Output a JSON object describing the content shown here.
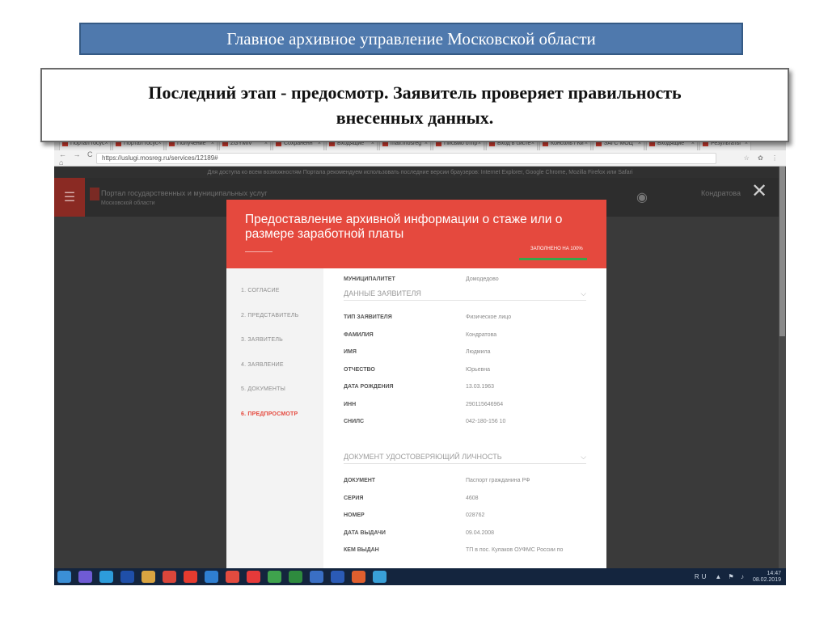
{
  "slide": {
    "title": "Главное архивное управление Московской области",
    "callout_line1": "Последний этап - предосмотр. Заявитель проверяет правильность",
    "callout_line2": "внесенных данных."
  },
  "browser": {
    "tabs": [
      "Портал госус",
      "Портал госус",
      "Получение",
      "ZGYMIV",
      "Сохраненн",
      "Входящие",
      "mail.mosreg",
      "Письмо отпр",
      "Вход в систе",
      "Консоль / Ки",
      "ЗАГС МОЦ",
      "Входящие",
      "Результаты"
    ],
    "nav_icons": "← → C ⌂",
    "url": "https://uslugi.mosreg.ru/services/12189#",
    "infobar": "Для доступа ко всем возможностям Портала рекомендуем использовать последние версии браузеров: Internet Explorer, Google Chrome, Mozilla Firefox или Safari",
    "menu_icon": "☰",
    "portal_name": "Портал государственных и муниципальных услуг",
    "portal_sub": "Московской области",
    "header_user": "Кондратова",
    "close_symbol": "✕"
  },
  "modal": {
    "title": "Предоставление архивной информации о стаже или о размере заработной платы",
    "fill_status": "ЗАПОЛНЕНО НА 100%",
    "fill_fraction": 1.0,
    "steps": [
      "1.  СОГЛАСИЕ",
      "2.  ПРЕДСТАВИТЕЛЬ",
      "3.  ЗАЯВИТЕЛЬ",
      "4.  ЗАЯВЛЕНИЕ",
      "5.  ДОКУМЕНТЫ",
      "6.  ПРЕДПРОСМОТР"
    ],
    "municipality_label": "МУНИЦИПАЛИТЕТ",
    "municipality_value": "Домодедово",
    "section_applicant": "ДАННЫЕ ЗАЯВИТЕЛЯ",
    "applicant_rows": [
      {
        "label": "ТИП ЗАЯВИТЕЛЯ",
        "value": "Физическое лицо"
      },
      {
        "label": "ФАМИЛИЯ",
        "value": "Кондратова"
      },
      {
        "label": "ИМЯ",
        "value": "Людмила"
      },
      {
        "label": "ОТЧЕСТВО",
        "value": "Юрьевна"
      },
      {
        "label": "ДАТА РОЖДЕНИЯ",
        "value": "13.03.1963"
      },
      {
        "label": "ИНН",
        "value": "290115646964"
      },
      {
        "label": "СНИЛС",
        "value": "042-180-156 10"
      }
    ],
    "section_document": "ДОКУМЕНТ УДОСТОВЕРЯЮЩИЙ ЛИЧНОСТЬ",
    "document_rows": [
      {
        "label": "ДОКУМЕНТ",
        "value": "Паспорт гражданина РФ"
      },
      {
        "label": "СЕРИЯ",
        "value": "4608"
      },
      {
        "label": "НОМЕР",
        "value": "028762"
      },
      {
        "label": "ДАТА ВЫДАЧИ",
        "value": "09.04.2008"
      },
      {
        "label": "КЕМ ВЫДАН",
        "value": "ТП в пос. Кулаков ОУФМС России по"
      }
    ]
  },
  "taskbar": {
    "icon_colors": [
      "#3b8fd6",
      "#6f5bd4",
      "#2d9cdb",
      "#1f4fa8",
      "#d9a441",
      "#d9463b",
      "#e53b2f",
      "#2f7fd1",
      "#e34b3f",
      "#e63a3a",
      "#3fa34d",
      "#2e8b3e",
      "#3a6fc4",
      "#2b5bb6",
      "#e05f2e",
      "#39a0d8"
    ],
    "lang": "RU",
    "time": "14:47",
    "date": "08.02.2019"
  }
}
